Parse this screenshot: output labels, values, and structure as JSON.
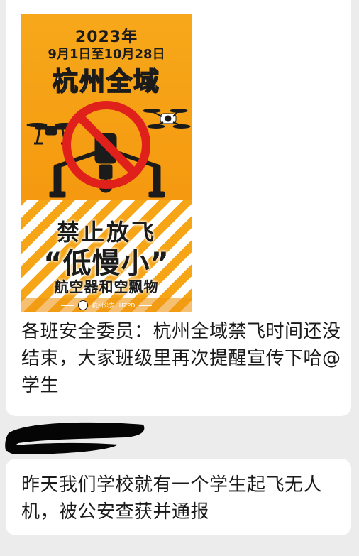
{
  "poster": {
    "year": "2023年",
    "dates": "9月1日至10月28日",
    "region": "杭州全域",
    "ban": "禁止放飞",
    "tagline": "“低慢小”",
    "objects": "航空器和空飘物",
    "footer_org": "杭州公安",
    "footer_code": "HZPD",
    "colors": {
      "background": "#f7a81a",
      "prohibition_red": "#e0201b",
      "stripe": "#ffffff"
    }
  },
  "messages": [
    {
      "text": "各班安全委员：杭州全域禁飞时间还没结束，大家班级里再次提醒宣传下哈@学生"
    },
    {
      "text": "昨天我们学校就有一个学生起飞无人机，被公安查获并通报"
    }
  ]
}
